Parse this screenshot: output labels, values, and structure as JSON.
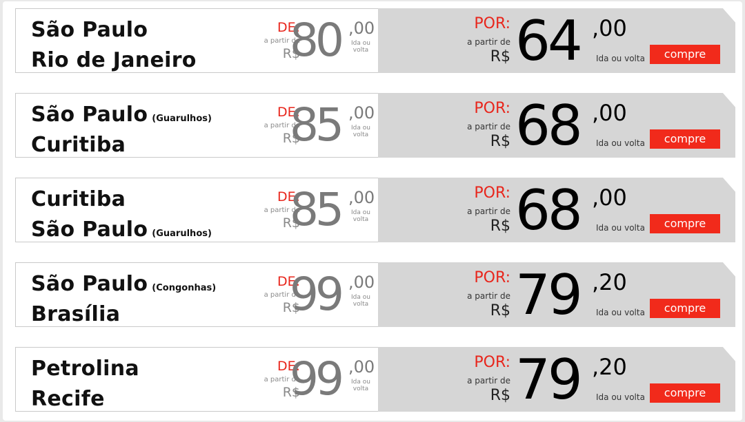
{
  "labels": {
    "de": "DE:",
    "por": "POR:",
    "a_partir_de": "a partir de",
    "currency": "R$",
    "ida_ou_volta": "Ida ou volta",
    "buy": "compre"
  },
  "offers": [
    {
      "from_city": "São Paulo",
      "from_airport": "",
      "to_city": "Rio de Janeiro",
      "to_airport": "",
      "old_price": "80",
      "old_cents": ",00",
      "new_price": "64",
      "new_cents": ",00"
    },
    {
      "from_city": "São Paulo",
      "from_airport": "(Guarulhos)",
      "to_city": "Curitiba",
      "to_airport": "",
      "old_price": "85",
      "old_cents": ",00",
      "new_price": "68",
      "new_cents": ",00"
    },
    {
      "from_city": "Curitiba",
      "from_airport": "",
      "to_city": "São Paulo",
      "to_airport": "(Guarulhos)",
      "old_price": "85",
      "old_cents": ",00",
      "new_price": "68",
      "new_cents": ",00"
    },
    {
      "from_city": "São Paulo",
      "from_airport": "(Congonhas)",
      "to_city": "Brasília",
      "to_airport": "",
      "old_price": "99",
      "old_cents": ",00",
      "new_price": "79",
      "new_cents": ",20"
    },
    {
      "from_city": "Petrolina",
      "from_airport": "",
      "to_city": "Recife",
      "to_airport": "",
      "old_price": "99",
      "old_cents": ",00",
      "new_price": "79",
      "new_cents": ",20"
    }
  ],
  "colors": {
    "accent_red": "#f12a1b",
    "panel_grey": "#d6d6d6"
  }
}
